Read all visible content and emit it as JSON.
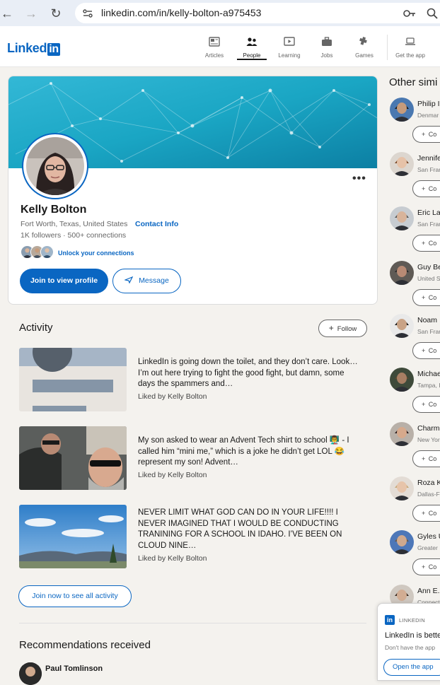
{
  "browser": {
    "url": "linkedin.com/in/kelly-bolton-a975453"
  },
  "topnav": {
    "logo_text": "Linked",
    "logo_in": "in",
    "items": [
      {
        "label": "Articles",
        "icon": "articles-icon"
      },
      {
        "label": "People",
        "icon": "people-icon",
        "active": true
      },
      {
        "label": "Learning",
        "icon": "learning-icon"
      },
      {
        "label": "Jobs",
        "icon": "jobs-icon"
      },
      {
        "label": "Games",
        "icon": "games-icon"
      },
      {
        "label": "Get the app",
        "icon": "laptop-icon"
      }
    ]
  },
  "profile": {
    "name": "Kelly Bolton",
    "location": "Fort Worth, Texas, United States",
    "contact_label": "Contact Info",
    "followers": "1K followers",
    "connections": "500+ connections",
    "unlock_label": "Unlock your connections",
    "join_button": "Join to view profile",
    "message_button": "Message",
    "more_label": "•••"
  },
  "activity": {
    "title": "Activity",
    "follow_label": "Follow",
    "posts": [
      {
        "text": "LinkedIn is going down the toilet, and they don’t care. Look… I’m out here trying to fight the good fight, but damn, some days the spammers and…",
        "meta": "Liked by Kelly Bolton"
      },
      {
        "text": "My son asked to wear an Advent Tech shirt to school 👨‍🏫 - I called him “mini me,” which is a joke he didn’t get LOL 😂 represent my son! Advent…",
        "meta": "Liked by Kelly Bolton"
      },
      {
        "text": "NEVER LIMIT WHAT GOD CAN DO IN YOUR LIFE!!!! I NEVER IMAGINED THAT I WOULD BE CONDUCTING TRANINING FOR A SCHOOL IN IDAHO. I’VE BEEN ON CLOUD NINE…",
        "meta": "Liked by Kelly Bolton"
      }
    ],
    "see_all_label": "Join now to see all activity"
  },
  "recommendations": {
    "title": "Recommendations received",
    "first_name": "Paul Tomlinson"
  },
  "sidebar": {
    "title": "Other simi",
    "connect_label": "Co",
    "people": [
      {
        "name": "Philip I",
        "loc": "Denmar"
      },
      {
        "name": "Jennife",
        "loc": "San Fran"
      },
      {
        "name": "Eric La",
        "loc": "San Fran"
      },
      {
        "name": "Guy Be",
        "loc": "United S"
      },
      {
        "name": "Noam",
        "loc": "San Fran"
      },
      {
        "name": "Michae",
        "loc": "Tampa, I"
      },
      {
        "name": "Charm",
        "loc": "New Yor"
      },
      {
        "name": "Roza K",
        "loc": "Dallas-F"
      },
      {
        "name": "Gyles U",
        "loc": "Greater"
      },
      {
        "name": "Ann E.",
        "loc": "Connect"
      }
    ]
  },
  "popup": {
    "brand": "LINKEDIN",
    "headline": "LinkedIn is bette",
    "sub": "Don't have the app",
    "button": "Open the app"
  },
  "colors": {
    "brand": "#0a66c2",
    "background": "#f4f2ee",
    "cover": "#1aa6c4"
  }
}
